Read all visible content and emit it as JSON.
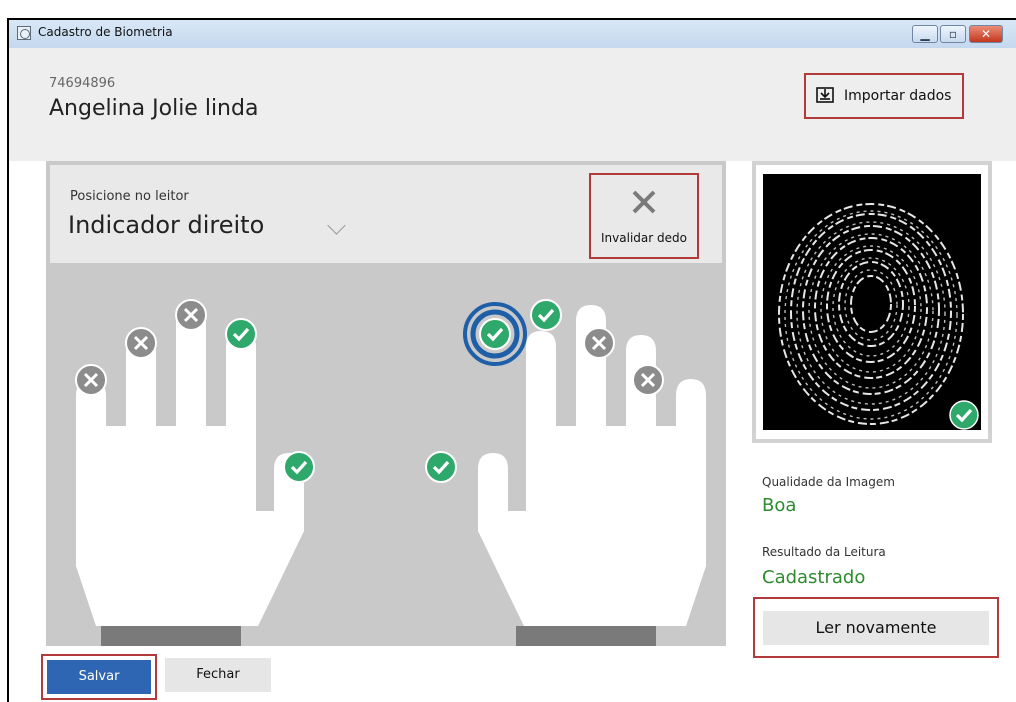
{
  "window": {
    "title": "Cadastro de Biometria",
    "controls": {
      "minimize": "▁",
      "maximize": "▫",
      "close": "✕"
    }
  },
  "header": {
    "user_id": "74694896",
    "user_name": "Angelina Jolie linda",
    "import_label": "Importar dados",
    "import_icon": "import-tray-icon"
  },
  "finger_panel": {
    "position_label": "Posicione no leitor",
    "selected_finger": "Indicador direito",
    "invalidate_label": "Invalidar dedo",
    "fingers": [
      {
        "hand": "left",
        "finger": "minimo",
        "status": "invalid"
      },
      {
        "hand": "left",
        "finger": "anelar",
        "status": "invalid"
      },
      {
        "hand": "left",
        "finger": "medio",
        "status": "invalid"
      },
      {
        "hand": "left",
        "finger": "indicador",
        "status": "ok"
      },
      {
        "hand": "left",
        "finger": "polegar",
        "status": "ok"
      },
      {
        "hand": "right",
        "finger": "polegar",
        "status": "ok"
      },
      {
        "hand": "right",
        "finger": "indicador",
        "status": "ok",
        "active": true
      },
      {
        "hand": "right",
        "finger": "medio",
        "status": "ok"
      },
      {
        "hand": "right",
        "finger": "anelar",
        "status": "invalid"
      },
      {
        "hand": "right",
        "finger": "minimo",
        "status": "invalid"
      }
    ],
    "colors": {
      "ok": "#2ea86b",
      "invalid": "#8c8c8c",
      "active_ring": "#1f5fa8",
      "panel": "#c9c9c9"
    }
  },
  "scan": {
    "quality_label": "Qualidade da Imagem",
    "quality_value": "Boa",
    "result_label": "Resultado da Leitura",
    "result_value": "Cadastrado",
    "reread_label": "Ler novamente"
  },
  "footer": {
    "save_label": "Salvar",
    "close_label": "Fechar"
  }
}
